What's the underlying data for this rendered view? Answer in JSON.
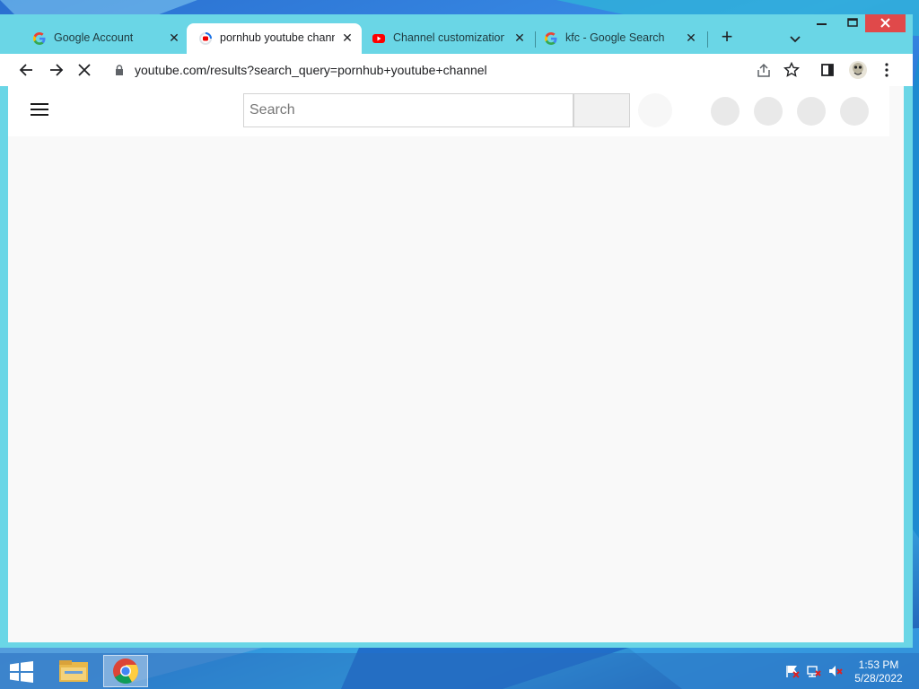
{
  "tabs": [
    {
      "title": "Google Account",
      "favicon": "google-g-icon",
      "active": false
    },
    {
      "title": "pornhub youtube chann",
      "favicon": "loading-icon",
      "active": true
    },
    {
      "title": "Channel customization",
      "favicon": "youtube-icon",
      "active": false
    },
    {
      "title": "kfc - Google Search",
      "favicon": "google-g-icon",
      "active": false
    }
  ],
  "toolbar": {
    "url": "youtube.com/results?search_query=pornhub+youtube+channel"
  },
  "page": {
    "search_placeholder": "Search"
  },
  "taskbar": {
    "time": "1:53 PM",
    "date": "5/28/2022"
  },
  "colors": {
    "window_frame": "#6ad6e6",
    "close_button": "#e0494a",
    "page_background": "#f9f9f9"
  }
}
